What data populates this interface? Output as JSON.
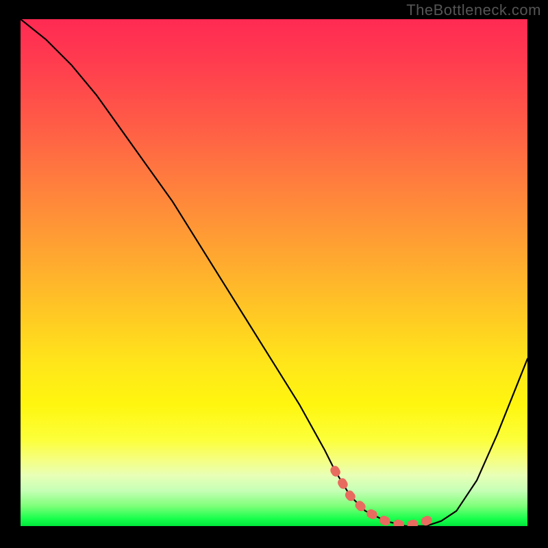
{
  "watermark": "TheBottleneck.com",
  "chart_data": {
    "type": "line",
    "title": "",
    "xlabel": "",
    "ylabel": "",
    "xlim": [
      0,
      100
    ],
    "ylim": [
      0,
      100
    ],
    "series": [
      {
        "name": "bottleneck-curve",
        "x": [
          0,
          5,
          10,
          15,
          20,
          25,
          30,
          35,
          40,
          45,
          50,
          55,
          60,
          62,
          65,
          68,
          72,
          76,
          80,
          83,
          86,
          90,
          94,
          98,
          100
        ],
        "y": [
          100,
          96,
          91,
          85,
          78,
          71,
          64,
          56,
          48,
          40,
          32,
          24,
          15,
          11,
          6,
          3,
          1,
          0,
          0,
          1,
          3,
          9,
          18,
          28,
          33
        ]
      }
    ],
    "markers": {
      "name": "valley-dots",
      "color": "#e86b5f",
      "x": [
        62,
        65,
        68,
        70,
        72,
        74,
        76,
        78,
        80,
        82
      ],
      "y": [
        11,
        6,
        3,
        2,
        1,
        0.5,
        0,
        0.5,
        1,
        2
      ]
    },
    "gradient_background": {
      "top_color": "#ff2a53",
      "mid_color": "#ffe61a",
      "bottom_color": "#00e83c"
    }
  }
}
